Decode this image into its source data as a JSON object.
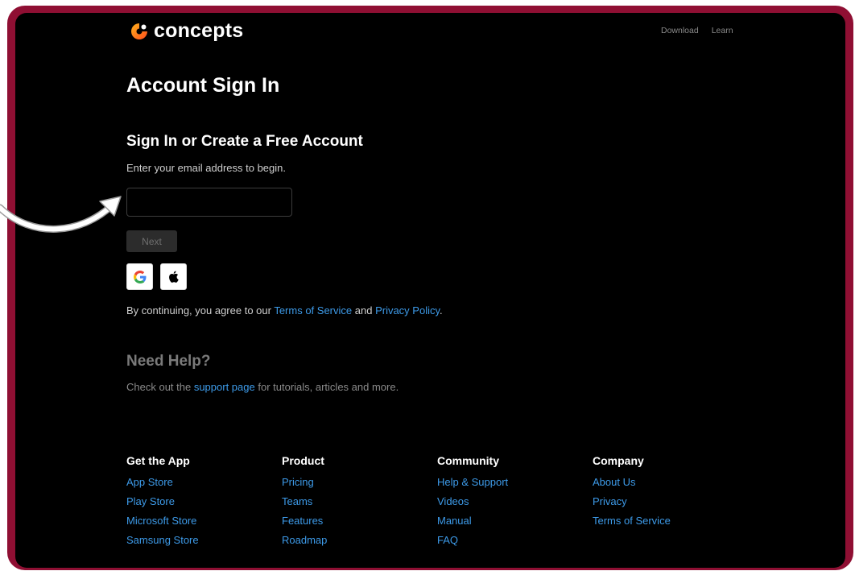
{
  "header": {
    "logo_text": "concepts",
    "nav": [
      "Download",
      "Learn"
    ]
  },
  "main": {
    "title": "Account Sign In",
    "subtitle": "Sign In or Create a Free Account",
    "intro": "Enter your email address to begin.",
    "email": {
      "value": "",
      "placeholder": ""
    },
    "next_label": "Next",
    "social": [
      {
        "name": "Google",
        "icon": "google-icon"
      },
      {
        "name": "Apple",
        "icon": "apple-icon"
      }
    ],
    "terms": {
      "prefix": "By continuing, you agree to our ",
      "tos_link": "Terms of Service",
      "and": " and ",
      "privacy_link": "Privacy Policy",
      "suffix": "."
    }
  },
  "help": {
    "title": "Need Help?",
    "prefix": "Check out the ",
    "link": "support page",
    "suffix": " for tutorials, articles and more."
  },
  "footer": {
    "columns": [
      {
        "title": "Get the App",
        "links": [
          "App Store",
          "Play Store",
          "Microsoft Store",
          "Samsung Store"
        ]
      },
      {
        "title": "Product",
        "links": [
          "Pricing",
          "Teams",
          "Features",
          "Roadmap"
        ]
      },
      {
        "title": "Community",
        "links": [
          "Help & Support",
          "Videos",
          "Manual",
          "FAQ"
        ]
      },
      {
        "title": "Company",
        "links": [
          "About Us",
          "Privacy",
          "Terms of Service"
        ]
      }
    ]
  },
  "colors": {
    "frame": "#8f0f33",
    "background": "#000000",
    "link": "#3d9ae8",
    "logo_orange": "#ff8a1c"
  }
}
